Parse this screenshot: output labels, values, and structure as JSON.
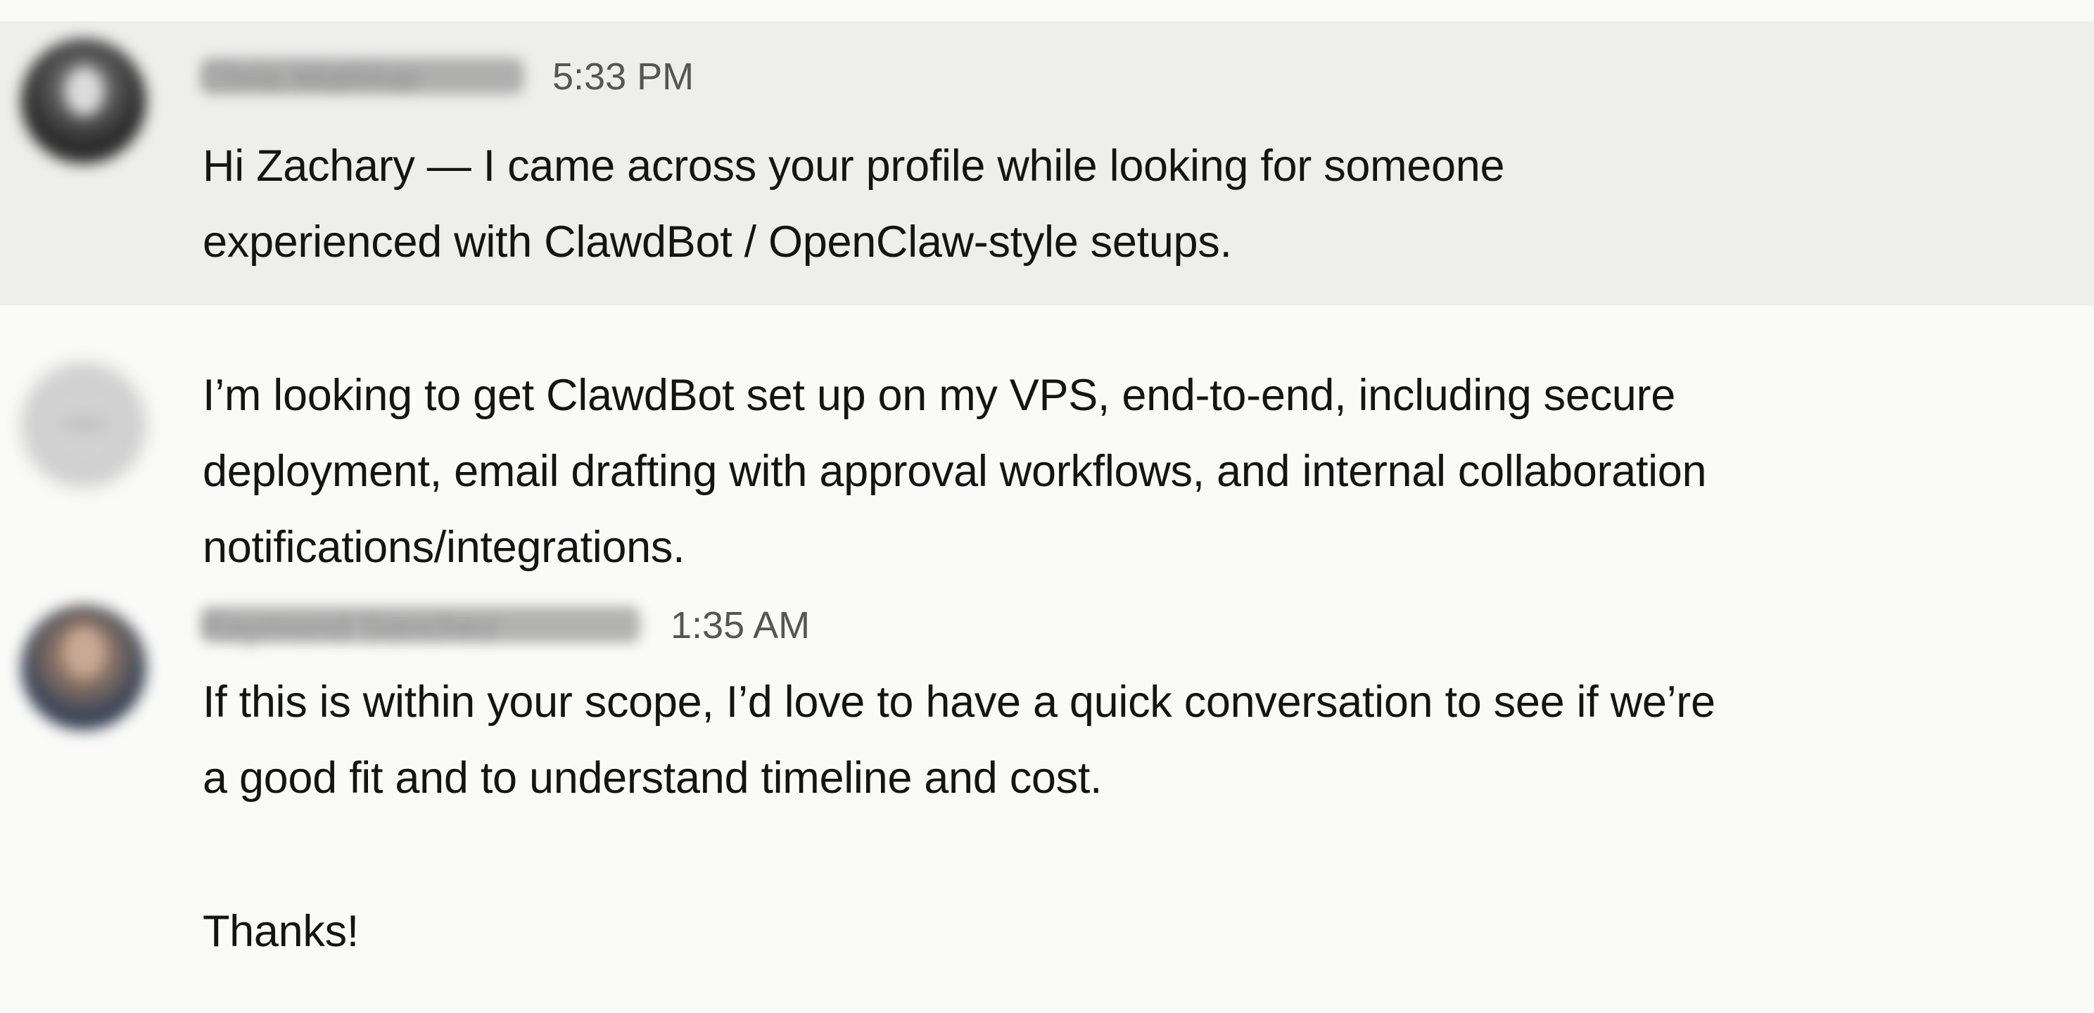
{
  "messages": [
    {
      "sender": "Chris Mathhar",
      "time": "5:33 PM",
      "lines": [
        "Hi Zachary — I came across your profile while looking for someone",
        "experienced with ClawdBot / OpenClaw-style setups."
      ]
    },
    {
      "lines": [
        "I’m looking to get ClawdBot set up on my VPS, end-to-end, including secure",
        "deployment, email drafting with approval workflows, and internal collaboration",
        "notifications/integrations."
      ]
    },
    {
      "sender": "Raymond Sanchez",
      "time": "1:35 AM",
      "lines": [
        "If this is within your scope, I’d love to have a quick conversation to see if we’re",
        "a good fit and to understand timeline and cost."
      ]
    },
    {
      "lines": [
        "Thanks!"
      ]
    }
  ],
  "colors": {
    "background": "#fafaf9",
    "highlight_row": "#eeeeed",
    "text": "#141414",
    "timestamp": "#555555"
  }
}
